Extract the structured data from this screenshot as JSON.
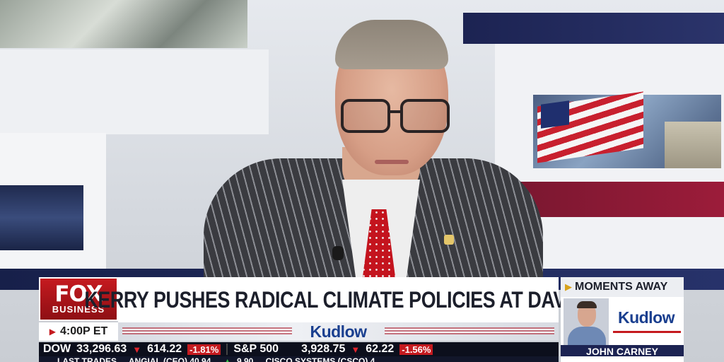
{
  "network": {
    "logo_main": "FOX",
    "logo_sub": "BUSINESS",
    "time": "4:00P ET"
  },
  "lower_third": {
    "headline": "KERRY PUSHES RADICAL CLIMATE POLICIES AT DAVOS",
    "show": "Kudlow"
  },
  "promo": {
    "label": "MOMENTS AWAY",
    "show": "Kudlow",
    "guest": "JOHN CARNEY"
  },
  "ticker": [
    {
      "name": "DOW",
      "value": "33,296.63",
      "change": "614.22",
      "pct": "-1.81%",
      "direction": "down"
    },
    {
      "name": "S&P 500",
      "value": "3,928.75",
      "change": "62.22",
      "pct": "-1.56%",
      "direction": "down"
    }
  ],
  "crawl": {
    "label": "LAST TRADES",
    "items": [
      "ANGIAL (CEO) 40.94",
      "9.90",
      "CISCO SYSTEMS (CSCO) 4"
    ]
  },
  "colors": {
    "fox_red": "#c51a1f",
    "navy": "#1c2352",
    "kudlow_blue": "#1a3f8f",
    "down_red": "#e0242c"
  }
}
